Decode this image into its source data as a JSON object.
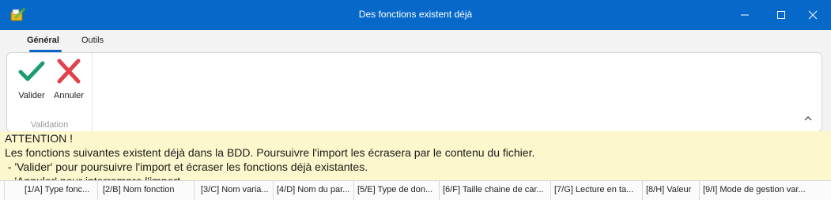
{
  "window": {
    "title": "Des fonctions existent déjà",
    "icon": "app-icon",
    "accent": "#0669c9"
  },
  "tabs": [
    {
      "label": "Général",
      "active": true
    },
    {
      "label": "Outils",
      "active": false
    }
  ],
  "ribbon": {
    "buttons": [
      {
        "label": "Valider",
        "icon": "check-icon",
        "color": "#1e9b6e"
      },
      {
        "label": "Annuler",
        "icon": "cross-icon",
        "color": "#e0434e"
      }
    ],
    "group_label": "Validation"
  },
  "message": {
    "background": "#fcf7cc",
    "lines": [
      "ATTENTION !",
      "Les fonctions suivantes existent déjà dans la BDD. Poursuivre l'import les écrasera par le contenu du fichier.",
      " - 'Valider' pour poursuivre l'import et écraser les fonctions déjà existantes.",
      " - 'Annuler' pour interrompre l'import."
    ]
  },
  "grid": {
    "columns": [
      "[1/A] Type fonc...",
      "[2/B] Nom fonction",
      "[3/C] Nom varia...",
      "[4/D] Nom du par...",
      "[5/E] Type de don...",
      "[6/F] Taille chaine de car...",
      "[7/G] Lecture en ta...",
      "[8/H] Valeur",
      "[9/I] Mode de gestion var..."
    ]
  }
}
